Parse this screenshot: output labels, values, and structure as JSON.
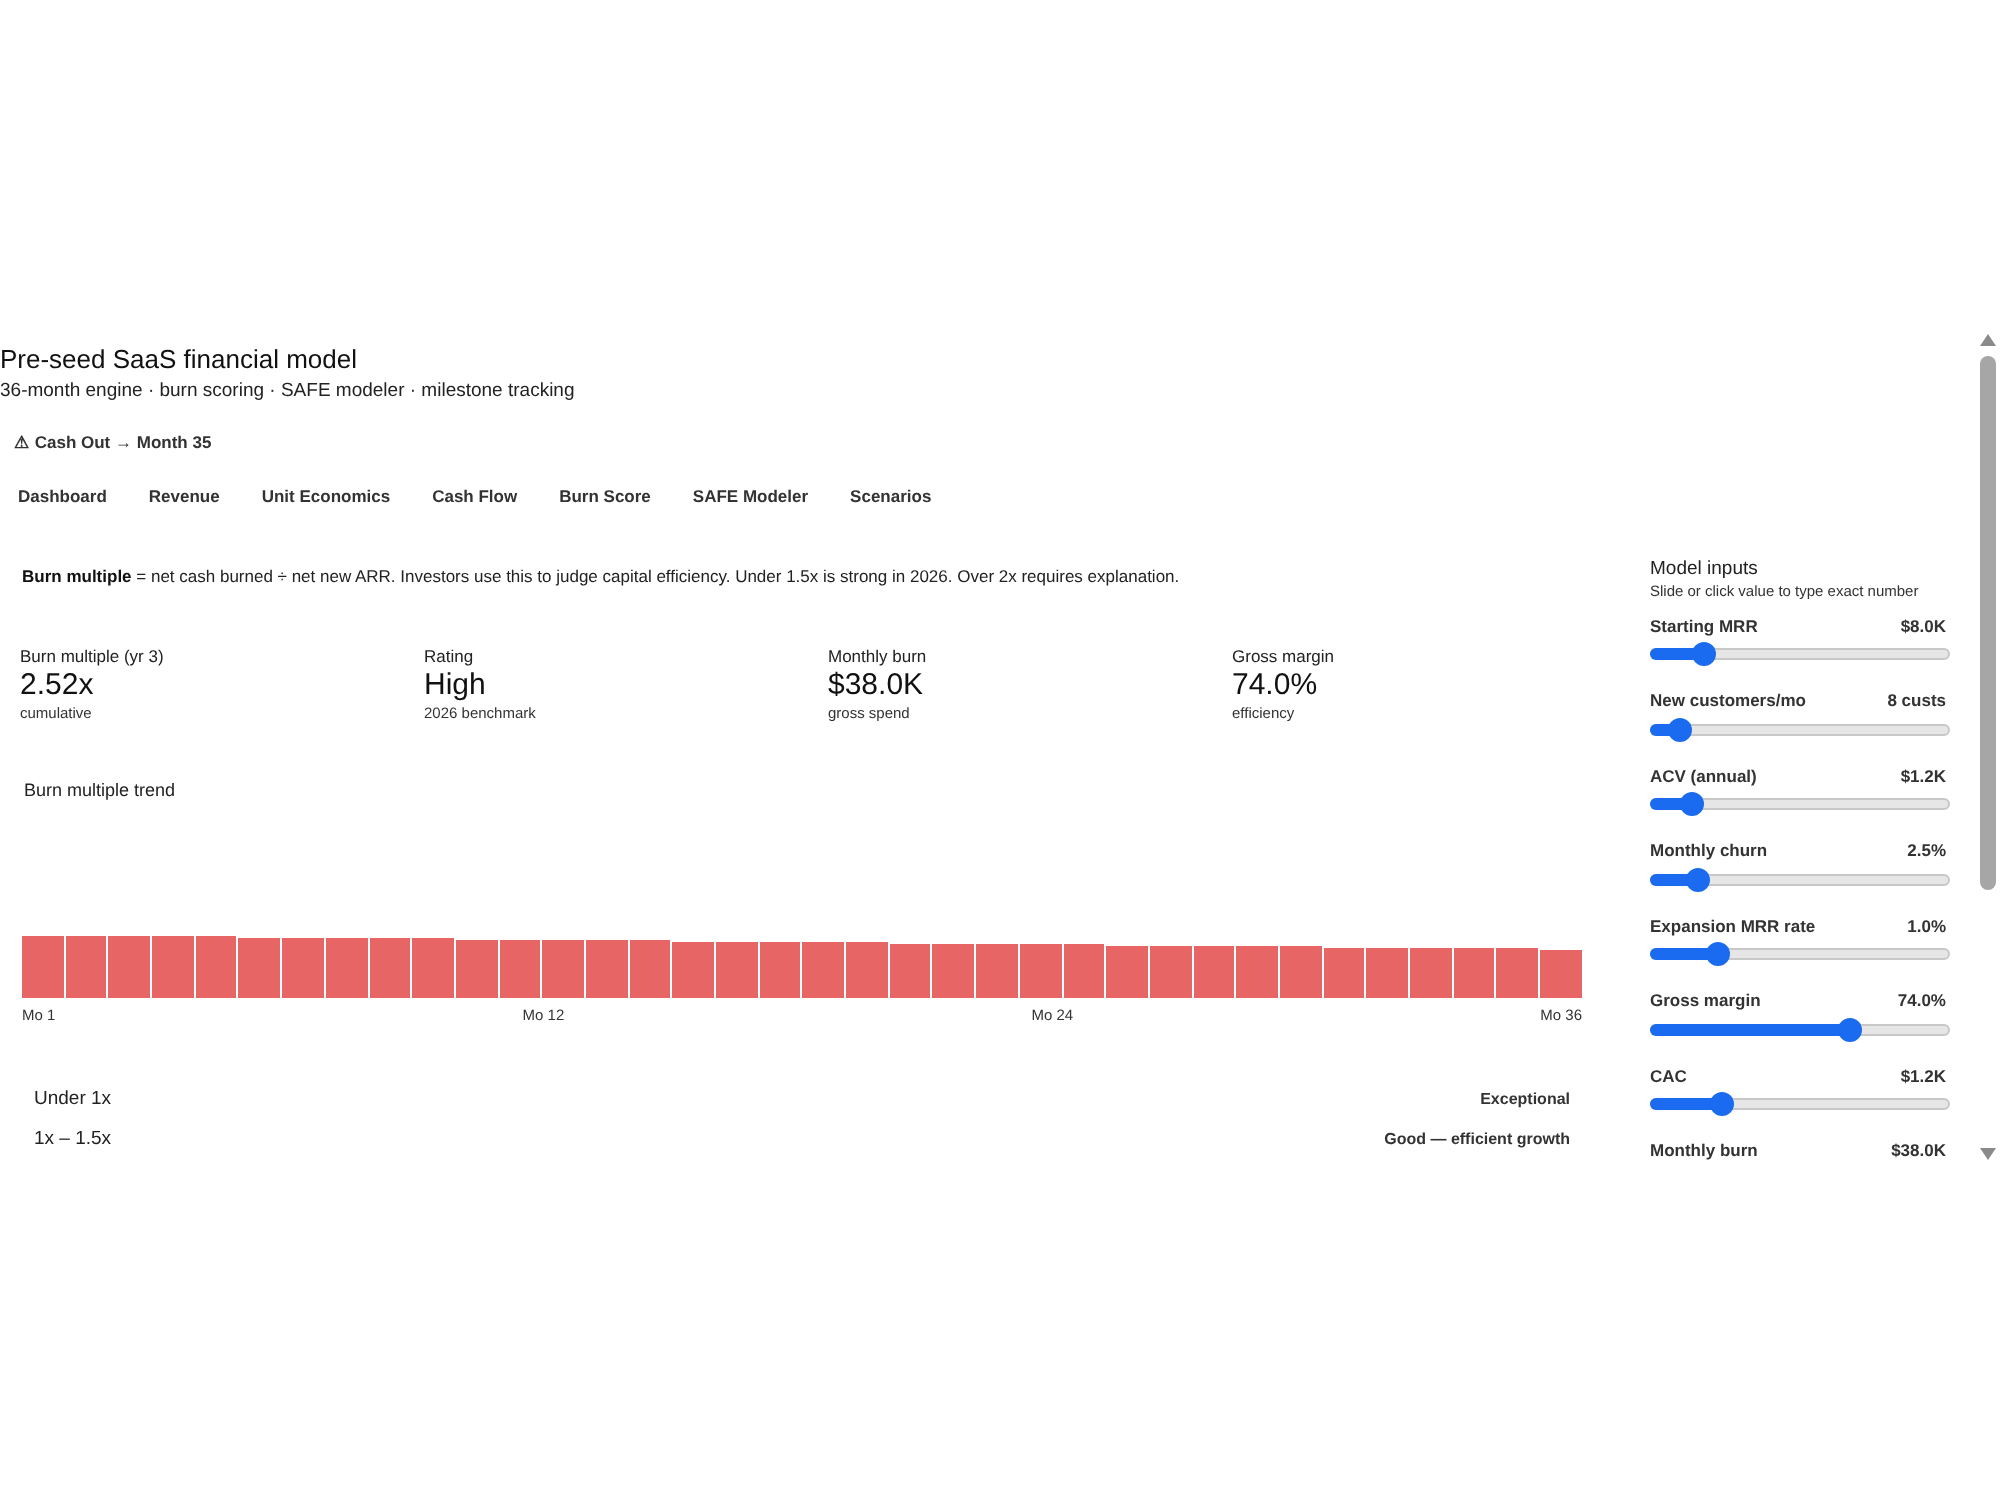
{
  "header": {
    "title": "Pre-seed SaaS financial model",
    "subtitle": "36-month engine · burn scoring · SAFE modeler · milestone tracking",
    "alert": "⚠ Cash Out → Month 35"
  },
  "tabs": [
    {
      "label": "Dashboard"
    },
    {
      "label": "Revenue"
    },
    {
      "label": "Unit Economics"
    },
    {
      "label": "Cash Flow"
    },
    {
      "label": "Burn Score"
    },
    {
      "label": "SAFE Modeler"
    },
    {
      "label": "Scenarios"
    }
  ],
  "intro": "**Burn multiple** = net cash burned ÷ net new ARR. Investors use this to judge capital efficiency. Under 1.5x is strong in 2026. Over 2x requires explanation.",
  "metrics": [
    {
      "label": "Burn multiple (yr 3)",
      "value": "2.52x",
      "note": "cumulative"
    },
    {
      "label": "Rating",
      "value": "High",
      "note": "2026 benchmark"
    },
    {
      "label": "Monthly burn",
      "value": "$38.0K",
      "note": "gross spend"
    },
    {
      "label": "Gross margin",
      "value": "74.0%",
      "note": "efficiency"
    }
  ],
  "chart": {
    "title": "Burn multiple trend",
    "x_labels": [
      "Mo 1",
      "Mo 12",
      "Mo 24",
      "Mo 36"
    ]
  },
  "bands": [
    {
      "range": "Under 1x",
      "label": "Exceptional"
    },
    {
      "range": "1x – 1.5x",
      "label": "Good — efficient growth"
    }
  ],
  "sidebar": {
    "title": "Model inputs",
    "hint": "Slide or click value to type exact number",
    "inputs": [
      {
        "label": "Starting MRR",
        "value": "$8.0K",
        "level": 0.15
      },
      {
        "label": "New customers/mo",
        "value": "8 custs",
        "level": 0.065
      },
      {
        "label": "ACV (annual)",
        "value": "$1.2K",
        "level": 0.11
      },
      {
        "label": "Monthly churn",
        "value": "2.5%",
        "level": 0.13
      },
      {
        "label": "Expansion MRR rate",
        "value": "1.0%",
        "level": 0.2
      },
      {
        "label": "Gross margin",
        "value": "74.0%",
        "level": 0.68
      },
      {
        "label": "CAC",
        "value": "$1.2K",
        "level": 0.22
      },
      {
        "label": "Monthly burn",
        "value": "$38.0K"
      }
    ]
  }
}
